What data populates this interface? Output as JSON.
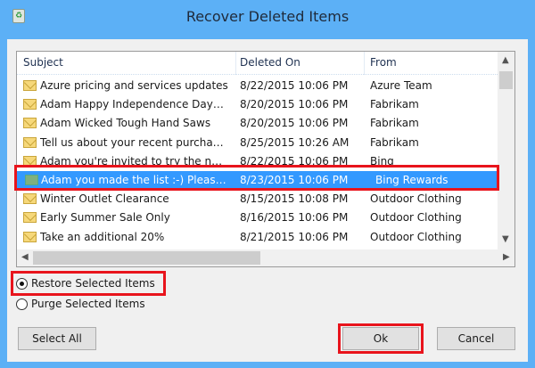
{
  "window": {
    "title": "Recover Deleted Items",
    "icon": "recycle-bin-icon"
  },
  "list": {
    "columns": [
      "Subject",
      "Deleted On",
      "From"
    ],
    "rows": [
      {
        "subject": "Azure pricing and services updates",
        "deleted": "8/22/2015 10:06 PM",
        "from": "Azure Team"
      },
      {
        "subject": "Adam Happy Independence Day…",
        "deleted": "8/20/2015 10:06 PM",
        "from": "Fabrikam"
      },
      {
        "subject": "Adam Wicked Tough  Hand Saws",
        "deleted": "8/20/2015 10:06 PM",
        "from": "Fabrikam"
      },
      {
        "subject": "Tell us about your recent purcha…",
        "deleted": "8/25/2015 10:26 AM",
        "from": "Fabrikam"
      },
      {
        "subject": "Adam you're invited to try the n…",
        "deleted": "8/22/2015 10:06 PM",
        "from": "Bing"
      },
      {
        "subject": "Adam you made the list :-) Pleas…",
        "deleted": "8/23/2015 10:06 PM",
        "from": "Bing Rewards",
        "selected": true
      },
      {
        "subject": "Winter Outlet Clearance",
        "deleted": "8/15/2015 10:08 PM",
        "from": "Outdoor Clothing"
      },
      {
        "subject": "Early Summer Sale Only",
        "deleted": "8/16/2015 10:06 PM",
        "from": "Outdoor Clothing"
      },
      {
        "subject": "Take an additional 20%",
        "deleted": "8/21/2015 10:06 PM",
        "from": "Outdoor Clothing"
      }
    ]
  },
  "options": {
    "restore": "Restore Selected Items",
    "purge": "Purge Selected Items",
    "selected": "restore"
  },
  "buttons": {
    "select_all": "Select All",
    "ok": "Ok",
    "cancel": "Cancel"
  },
  "colors": {
    "titlebar": "#5cb0f6",
    "selection": "#3399ff",
    "highlight": "#e8141c"
  }
}
